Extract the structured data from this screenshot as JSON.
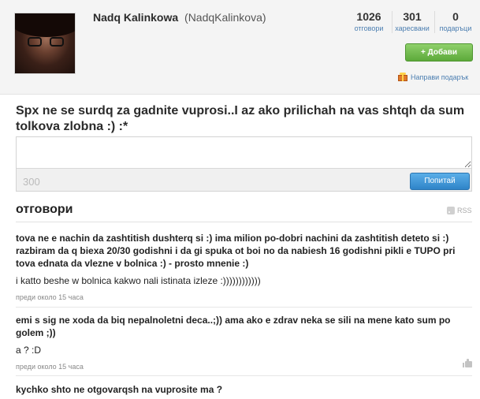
{
  "profile": {
    "name": "Nadq Kalinkowa",
    "handle": "(NadqKalinkova)",
    "stats": [
      {
        "value": "1026",
        "label": "отговори"
      },
      {
        "value": "301",
        "label": "харесвани"
      },
      {
        "value": "0",
        "label": "подаръци"
      }
    ],
    "add_button": "+ Добави",
    "gift_link": "Направи подарък"
  },
  "question": "Spx ne se surdq za gadnite vuprosi..I az ako prilichah na vas shtqh da sum tolkova zlobna :) :*",
  "ask": {
    "input_value": "",
    "counter": "300",
    "button": "Попитай"
  },
  "answers_section": {
    "title": "отговори",
    "rss": "RSS",
    "items": [
      {
        "question": "tova ne e nachin da zashtitish dushterq si :) ima milion po-dobri nachini da zashtitish deteto si :) razbiram da q biexa 20/30 godishni i da gi spuka ot boi no da nabiesh 16 godishni pikli e TUPO pri tova ednata da vlezne v bolnica :) - prosto mnenie :)",
        "answer": "i katto beshe w bolnica kakwo nali istinata izleze :))))))))))))",
        "time": "преди около 15 часа"
      },
      {
        "question": "emi s sig ne xoda da biq nepalnoletni deca..;)) ama ako e zdrav neka se sili na mene kato sum po golem ;))",
        "answer": "a ? :D",
        "time": "преди около 15 часа"
      },
      {
        "question": "kychko shto ne otgovarqsh na vuprosite ma ?",
        "answer": "",
        "time": ""
      }
    ]
  }
}
